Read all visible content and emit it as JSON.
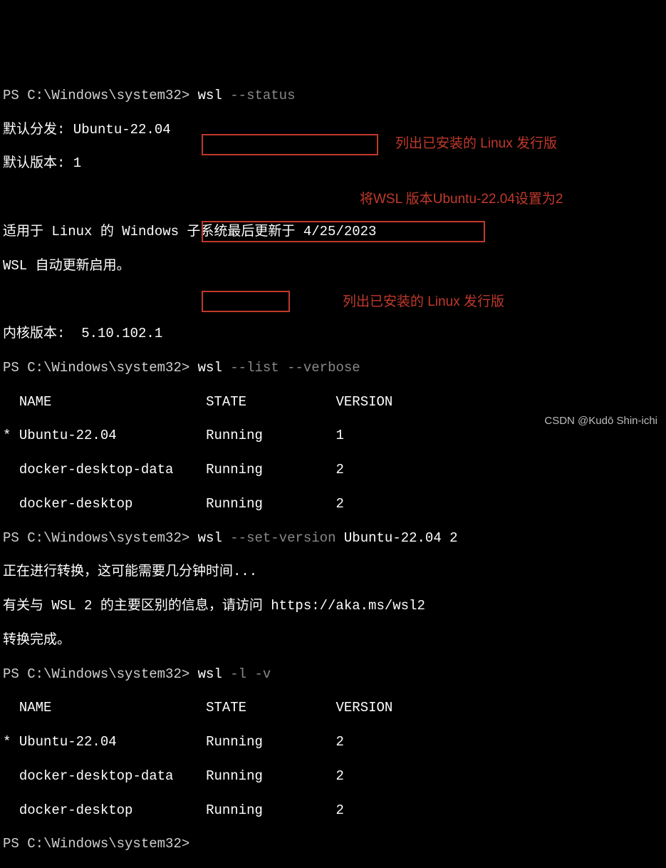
{
  "prompt": "PS C:\\Windows\\system32> ",
  "cmd1_text": "wsl ",
  "cmd1_args": "--status",
  "status": {
    "l1": "默认分发: Ubuntu-22.04",
    "l2": "默认版本: 1",
    "l3": "适用于 Linux 的 Windows 子系统最后更新于 4/25/2023",
    "l4": "WSL 自动更新启用。",
    "l5": "内核版本:  5.10.102.1"
  },
  "cmd2_text": "wsl ",
  "cmd2_args": "--list --verbose",
  "chart_data": {
    "type": "table",
    "columns": [
      "NAME",
      "STATE",
      "VERSION"
    ],
    "list1": [
      {
        "star": "*",
        "name": "Ubuntu-22.04",
        "state": "Running",
        "version": "1"
      },
      {
        "star": " ",
        "name": "docker-desktop-data",
        "state": "Running",
        "version": "2"
      },
      {
        "star": " ",
        "name": "docker-desktop",
        "state": "Running",
        "version": "2"
      }
    ],
    "list2": [
      {
        "star": "*",
        "name": "Ubuntu-22.04",
        "state": "Running",
        "version": "2"
      },
      {
        "star": " ",
        "name": "docker-desktop-data",
        "state": "Running",
        "version": "2"
      },
      {
        "star": " ",
        "name": "docker-desktop",
        "state": "Running",
        "version": "2"
      }
    ]
  },
  "cmd3_text": "wsl ",
  "cmd3_args": "--set-version",
  "cmd3_rest": " Ubuntu-22.04 2",
  "convert": {
    "l1": "正在进行转换，这可能需要几分钟时间...",
    "l2a": "有关与 WSL 2 的主要区别的信息，请访问 ",
    "l2b": "https://aka.ms/wsl2",
    "l3": "转换完成。"
  },
  "cmd4_text": "wsl ",
  "cmd4_args": "-l -v",
  "annotations": {
    "a1": "列出已安装的 Linux 发行版",
    "a2": "将WSL 版本Ubuntu-22.04设置为2",
    "a3": "列出已安装的 Linux 发行版"
  },
  "watermark": "CSDN @Kudō Shin-ichi"
}
